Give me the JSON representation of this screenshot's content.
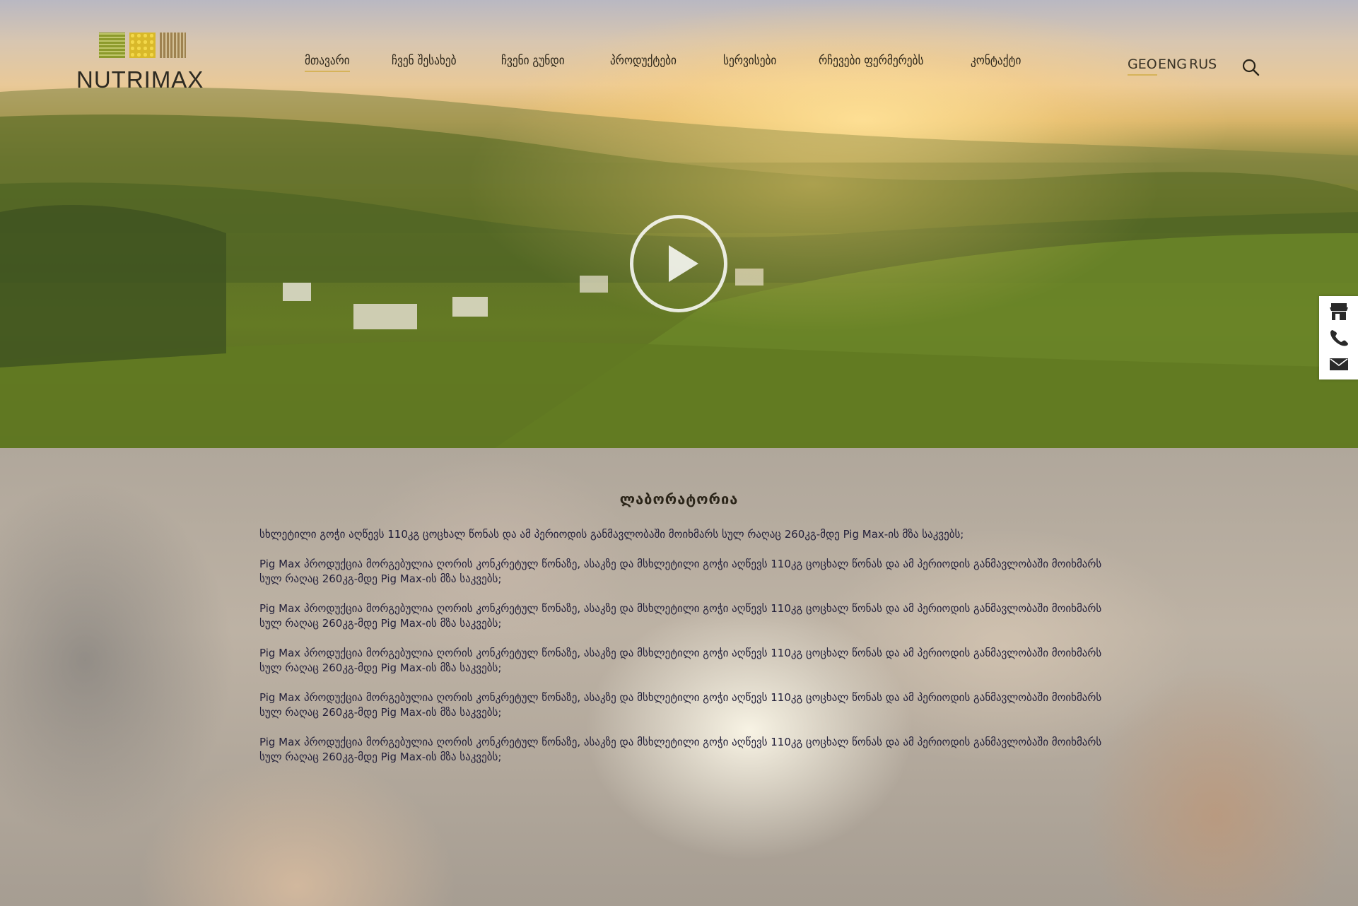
{
  "header": {
    "logo_text": "NUTRIMAX",
    "nav": [
      {
        "label": "მთავარი",
        "active": true
      },
      {
        "label": "ჩვენ შესახებ",
        "active": false
      },
      {
        "label": "ჩვენი გუნდი",
        "active": false
      },
      {
        "label": "პროდუქტები",
        "active": false
      },
      {
        "label": "სერვისები",
        "active": false
      },
      {
        "label": "რჩევები ფერმერებს",
        "active": false
      },
      {
        "label": "კონტაქტი",
        "active": false
      }
    ],
    "languages": [
      {
        "label": "GEO",
        "active": true
      },
      {
        "label": "ENG",
        "active": false
      },
      {
        "label": "RUS",
        "active": false
      }
    ],
    "search_icon": "search-icon"
  },
  "hero": {
    "play_icon": "play-icon"
  },
  "side_widget": {
    "icons": [
      "store-icon",
      "phone-icon",
      "mail-icon"
    ]
  },
  "section": {
    "title": "ლაბორატორია",
    "paragraphs": [
      "სხლეტილი გოჭი აღწევს 110კგ ცოცხალ წონას და ამ პერიოდის განმავლობაში მოიხმარს სულ რაღაც 260კგ-მდე Pig Max-ის მზა საკვებს;",
      "Pig Max პროდუქცია მორგებულია ღორის კონკრეტულ წონაზე, ასაკზე და მსხლეტილი გოჭი აღწევს 110კგ ცოცხალ წონას და ამ პერიოდის განმავლობაში მოიხმარს სულ რაღაც 260კგ-მდე Pig Max-ის მზა საკვებს;",
      "Pig Max პროდუქცია მორგებულია ღორის კონკრეტულ წონაზე, ასაკზე და მსხლეტილი გოჭი აღწევს 110კგ ცოცხალ წონას და ამ პერიოდის განმავლობაში მოიხმარს სულ რაღაც 260კგ-მდე Pig Max-ის მზა საკვებს;",
      "Pig Max პროდუქცია მორგებულია ღორის კონკრეტულ წონაზე, ასაკზე და მსხლეტილი გოჭი აღწევს 110კგ ცოცხალ წონას და ამ პერიოდის განმავლობაში მოიხმარს სულ რაღაც 260კგ-მდე Pig Max-ის მზა საკვებს;",
      "Pig Max პროდუქცია მორგებულია ღორის კონკრეტულ წონაზე, ასაკზე და მსხლეტილი გოჭი აღწევს 110კგ ცოცხალ წონას და ამ პერიოდის განმავლობაში მოიხმარს სულ რაღაც 260კგ-მდე Pig Max-ის მზა საკვებს;",
      "Pig Max პროდუქცია მორგებულია ღორის კონკრეტულ წონაზე, ასაკზე და მსხლეტილი გოჭი აღწევს 110კგ ცოცხალ წონას და ამ პერიოდის განმავლობაში მოიხმარს სულ რაღაც 260კგ-მდე Pig Max-ის მზა საკვებს;"
    ]
  },
  "colors": {
    "accent_underline": "#d6b35a",
    "text_dark": "#2a2418"
  }
}
